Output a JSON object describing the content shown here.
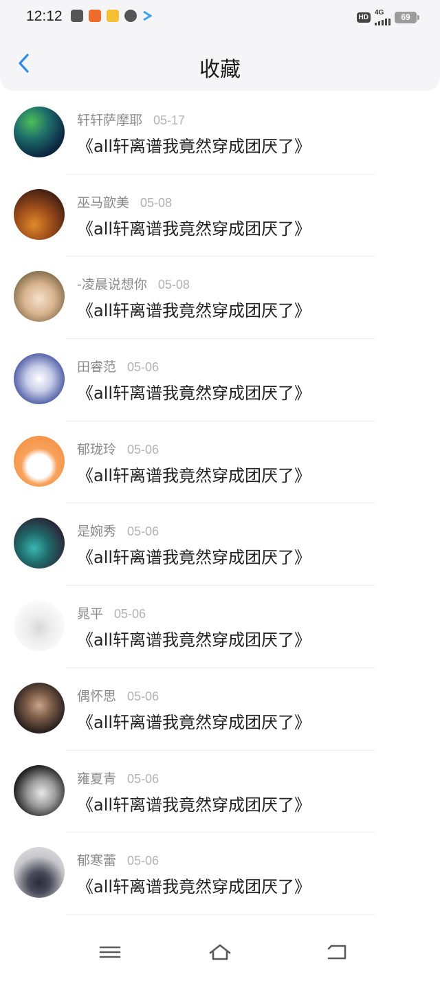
{
  "status_bar": {
    "time": "12:12",
    "hd_label": "HD",
    "network": "4G",
    "battery": "69",
    "app_icons": [
      "gallery-app-icon",
      "orange-app-icon",
      "weibo-app-icon",
      "message-app-icon",
      "play-arrow-icon"
    ]
  },
  "header": {
    "title": "收藏",
    "back_icon": "chevron-left-icon",
    "accent_color": "#2f8bef"
  },
  "items": [
    {
      "name": "轩轩萨摩耶",
      "date": "05-17",
      "title": "《all轩离谱我竟然穿成团厌了》"
    },
    {
      "name": "巫马歆美",
      "date": "05-08",
      "title": "《all轩离谱我竟然穿成团厌了》"
    },
    {
      "name": "-凌晨说想你",
      "date": "05-08",
      "title": "《all轩离谱我竟然穿成团厌了》"
    },
    {
      "name": "田睿范",
      "date": "05-06",
      "title": "《all轩离谱我竟然穿成团厌了》"
    },
    {
      "name": "郁珑玲",
      "date": "05-06",
      "title": "《all轩离谱我竟然穿成团厌了》"
    },
    {
      "name": "是婉秀",
      "date": "05-06",
      "title": "《all轩离谱我竟然穿成团厌了》"
    },
    {
      "name": "晁平",
      "date": "05-06",
      "title": "《all轩离谱我竟然穿成团厌了》"
    },
    {
      "name": "偶怀思",
      "date": "05-06",
      "title": "《all轩离谱我竟然穿成团厌了》"
    },
    {
      "name": "雍夏青",
      "date": "05-06",
      "title": "《all轩离谱我竟然穿成团厌了》"
    },
    {
      "name": "郁寒蕾",
      "date": "05-06",
      "title": "《all轩离谱我竟然穿成团厌了》"
    }
  ],
  "nav_bar": {
    "icons": [
      "menu-icon",
      "home-icon",
      "back-icon"
    ]
  }
}
